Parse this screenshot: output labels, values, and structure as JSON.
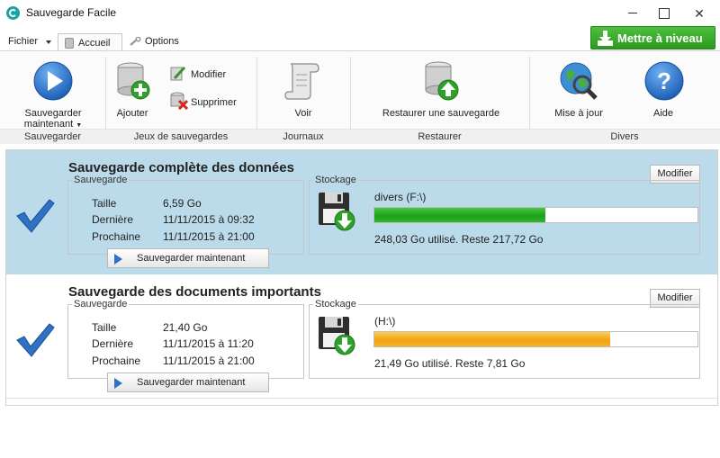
{
  "window": {
    "title": "Sauvegarde Facile",
    "minimize_icon": "minimize-icon",
    "maximize_icon": "maximize-icon",
    "close_icon": "close-icon",
    "close_glyph": "✕"
  },
  "menu": {
    "fichier": "Fichier",
    "tabs": [
      {
        "label": "Accueil",
        "icon": "database-icon",
        "active": true
      },
      {
        "label": "Options",
        "icon": "wrench-icon",
        "active": false
      }
    ],
    "upgrade": {
      "label": "Mettre à niveau",
      "icon": "download-icon",
      "color": "#2b9a20"
    }
  },
  "ribbon": {
    "groups": [
      "Sauvegarder",
      "Jeux de sauvegardes",
      "Journaux",
      "Restaurer",
      "Divers"
    ],
    "buttons": {
      "backup_now": {
        "line1": "Sauvegarder",
        "line2": "maintenant",
        "icon": "play-icon"
      },
      "add": {
        "label": "Ajouter",
        "icon": "database-add-icon"
      },
      "modify": {
        "label": "Modifier",
        "icon": "edit-icon"
      },
      "delete": {
        "label": "Supprimer",
        "icon": "delete-icon"
      },
      "view": {
        "label": "Voir",
        "icon": "scroll-icon"
      },
      "restore": {
        "label": "Restaurer une sauvegarde",
        "icon": "database-restore-icon"
      },
      "update": {
        "label": "Mise à jour",
        "icon": "globe-search-icon"
      },
      "help": {
        "label": "Aide",
        "icon": "help-icon"
      }
    }
  },
  "backups": [
    {
      "title": "Sauvegarde complète des données",
      "modify_label": "Modifier",
      "backup_legend": "Sauvegarde",
      "size_label": "Taille",
      "size": "6,59 Go",
      "last_label": "Dernière",
      "last": "11/11/2015 à 09:32",
      "next_label": "Prochaine",
      "next": "11/11/2015 à 21:00",
      "save_now_label": "Sauvegarder maintenant",
      "storage_legend": "Stockage",
      "drive": "divers (F:\\)",
      "usage": "248,03 Go utilisé. Reste 217,72 Go",
      "used_fraction": 0.53,
      "bar_color": "#1fa01a",
      "selected": true
    },
    {
      "title": "Sauvegarde des documents importants",
      "modify_label": "Modifier",
      "backup_legend": "Sauvegarde",
      "size_label": "Taille",
      "size": "21,40 Go",
      "last_label": "Dernière",
      "last": "11/11/2015 à 11:20",
      "next_label": "Prochaine",
      "next": "11/11/2015 à 21:00",
      "save_now_label": "Sauvegarder maintenant",
      "storage_legend": "Stockage",
      "drive": "(H:\\)",
      "usage": "21,49 Go utilisé. Reste 7,81 Go",
      "used_fraction": 0.73,
      "bar_color": "#f2a30f",
      "selected": false
    }
  ],
  "colors": {
    "selected_row": "#bcdbea",
    "accent_blue": "#2f72c4"
  }
}
